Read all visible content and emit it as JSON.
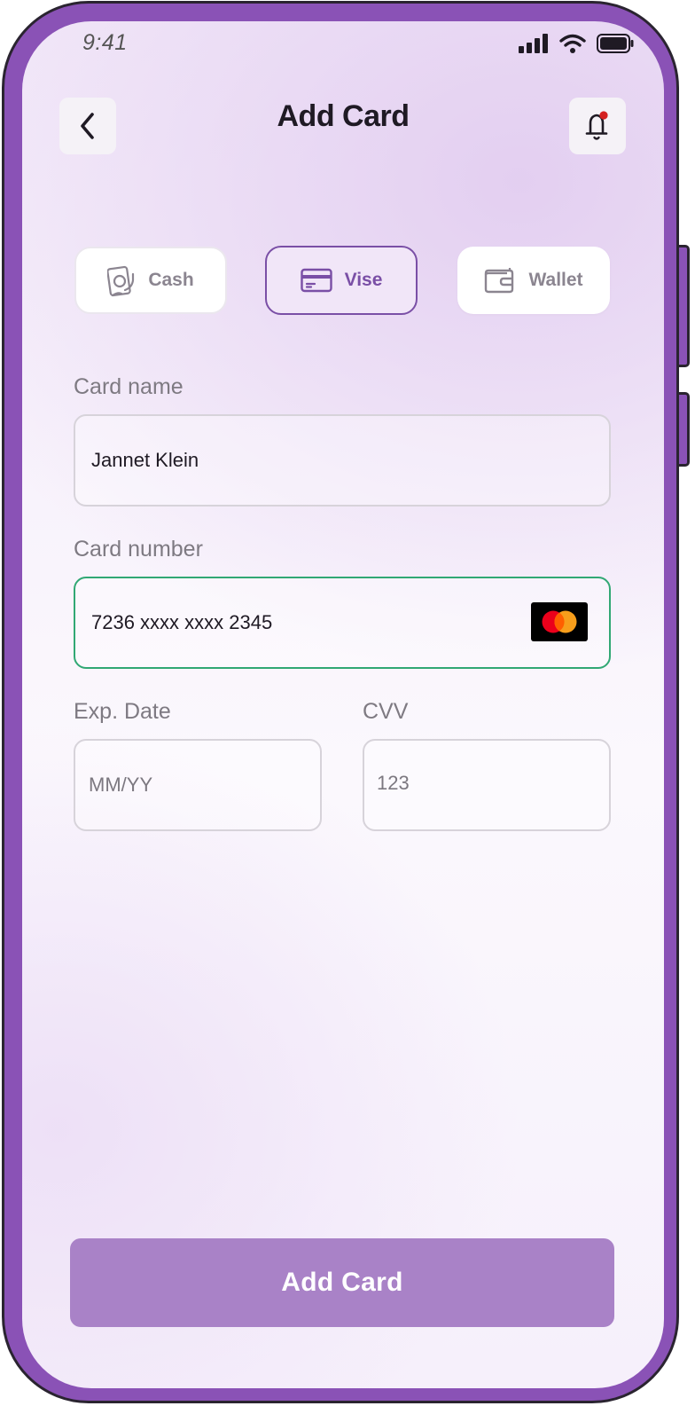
{
  "status_bar": {
    "time": "9:41",
    "signal_icon": "signal-icon",
    "wifi_icon": "wifi-icon",
    "battery_icon": "battery-icon"
  },
  "header": {
    "title": "Add Card",
    "back_icon": "chevron-left-icon",
    "notification_icon": "bell-icon"
  },
  "payment_methods": [
    {
      "label": "Cash",
      "icon": "cash-icon",
      "selected": false
    },
    {
      "label": "Vise",
      "icon": "card-icon",
      "selected": true
    },
    {
      "label": "Wallet",
      "icon": "wallet-icon",
      "selected": false
    }
  ],
  "form": {
    "card_name": {
      "label": "Card name",
      "value": "Jannet Klein"
    },
    "card_number": {
      "label": "Card number",
      "value": "7236 xxxx xxxx 2345",
      "brand_icon": "mastercard-icon"
    },
    "exp_date": {
      "label": "Exp. Date",
      "placeholder": "MM/YY"
    },
    "cvv": {
      "label": "CVV",
      "placeholder": "123"
    }
  },
  "submit": {
    "label": "Add Card"
  },
  "colors": {
    "frame": "#8a52b6",
    "accent": "#7a4fa6",
    "button": "#a982c7",
    "focus_border": "#31a874",
    "notification_dot": "#d42020"
  }
}
